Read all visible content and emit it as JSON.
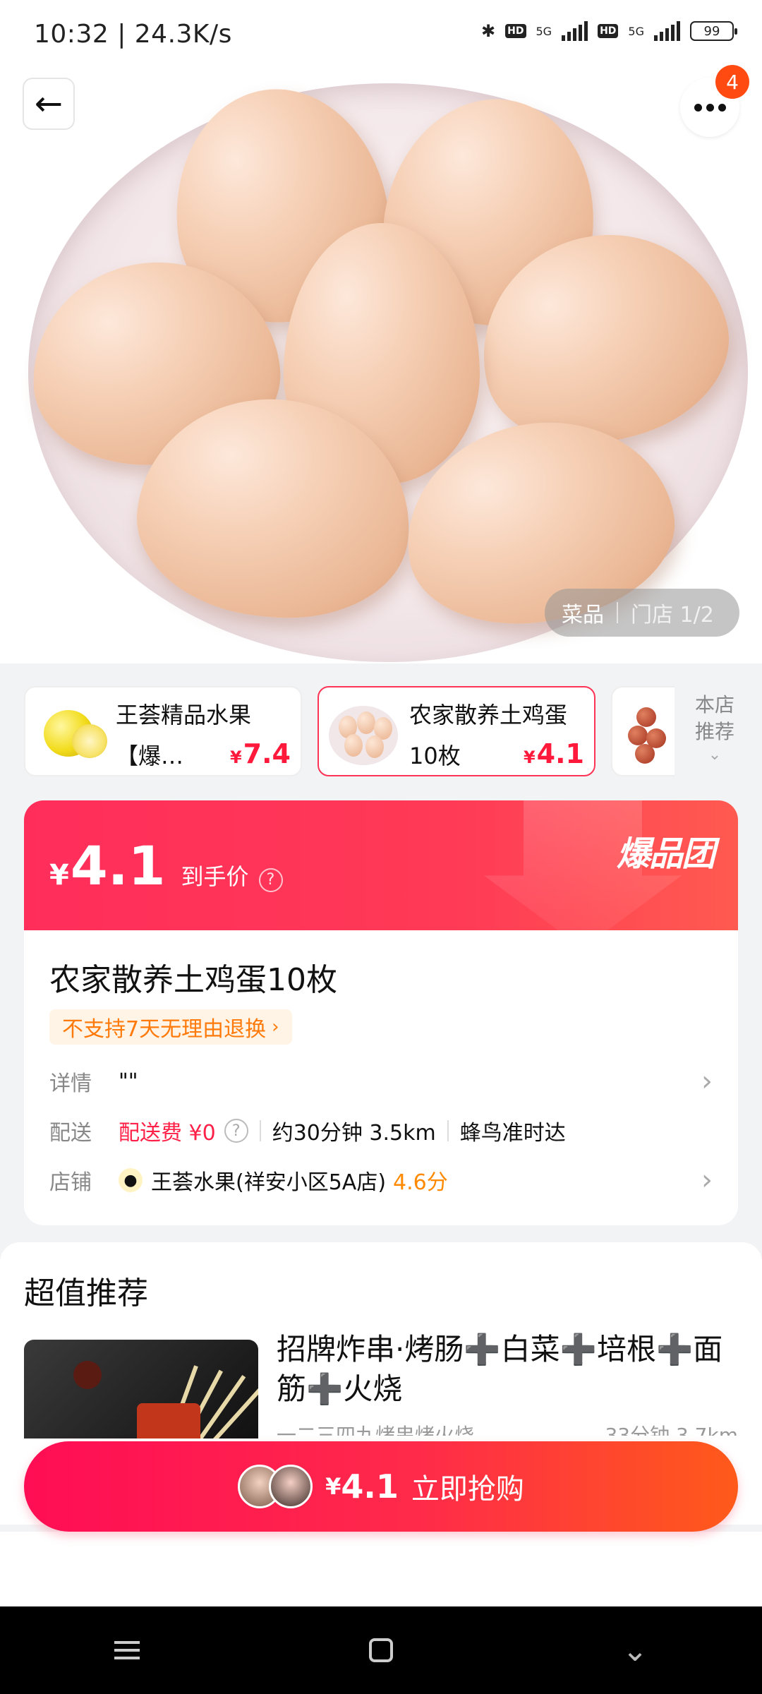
{
  "status_bar": {
    "time": "10:32 | 24.3K/s",
    "net_label_1": "5G",
    "net_label_2": "5G",
    "hd": "HD",
    "battery": "99"
  },
  "header": {
    "back_icon": "arrow-left-icon",
    "more_icon": "more-dots-icon",
    "notification_count": "4"
  },
  "gallery": {
    "tab_dish": "菜品",
    "tab_store": "门店 1/2"
  },
  "product_strip": {
    "items": [
      {
        "name": "王荟精品水果【爆…",
        "currency": "¥",
        "price": "7.4",
        "thumb": "pomelo"
      },
      {
        "name": "农家散养土鸡蛋10枚",
        "currency": "¥",
        "price": "4.1",
        "thumb": "eggs",
        "selected": true
      },
      {
        "name": "",
        "thumb": "dates"
      }
    ],
    "store_recommend": "本店推荐"
  },
  "deal": {
    "currency": "¥",
    "price": "4.1",
    "label": "到手价",
    "brand": "爆品团",
    "accent_color": "#ff2d5a"
  },
  "product": {
    "title": "农家散养土鸡蛋10枚",
    "return_policy": "不支持7天无理由退换",
    "detail_label": "详情",
    "detail_value": "\"\"",
    "delivery_label": "配送",
    "delivery_fee": "配送费 ¥0",
    "delivery_time": "约30分钟 3.5km",
    "delivery_service": "蜂鸟准时达",
    "store_label": "店铺",
    "store_name": "王荟水果(祥安小区5A店)",
    "store_rating": "4.6分"
  },
  "recommend": {
    "title": "超值推荐",
    "item_name": "招牌炸串·烤肠➕白菜➕培根➕面筋➕火烧",
    "item_sub": "一二三四九烤串烤火烧",
    "item_distance": "33分钟 3.7km"
  },
  "buy_button": {
    "currency": "¥",
    "price": "4.1",
    "label": "立即抢购"
  },
  "nav": {
    "menu_icon": "menu-icon",
    "home_icon": "home-icon",
    "back_icon": "chevron-down-icon"
  }
}
